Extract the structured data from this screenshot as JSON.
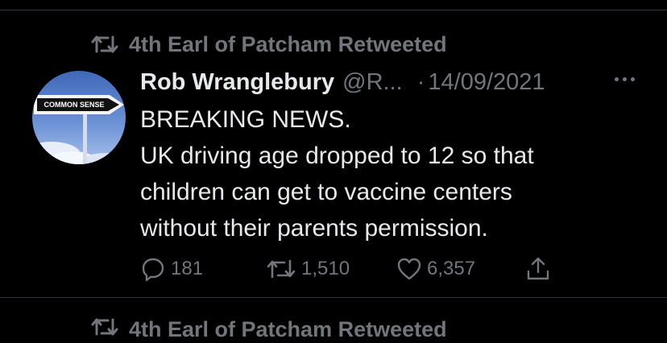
{
  "retweet_context": {
    "text": "4th Earl of Patcham Retweeted"
  },
  "tweet": {
    "author": {
      "display_name": "Rob Wranglebury",
      "handle": "@R...",
      "avatar_sign_text": "COMMON SENSE"
    },
    "separator": "·",
    "date": "14/09/2021",
    "lines": [
      "BREAKING NEWS.",
      "UK driving age dropped to 12 so that",
      "children can get to vaccine centers",
      "without their parents permission."
    ],
    "actions": {
      "replies": "181",
      "retweets": "1,510",
      "likes": "6,357"
    }
  },
  "next_item": {
    "retweet_text": "4th Earl of Patcham Retweeted"
  },
  "colors": {
    "background": "#000000",
    "primary_text": "#e7e9ea",
    "secondary_text": "#71767b",
    "divider": "#2f3336"
  },
  "icons": [
    "retweet-icon",
    "more-icon",
    "reply-icon",
    "retweet-icon",
    "like-icon",
    "share-icon"
  ]
}
